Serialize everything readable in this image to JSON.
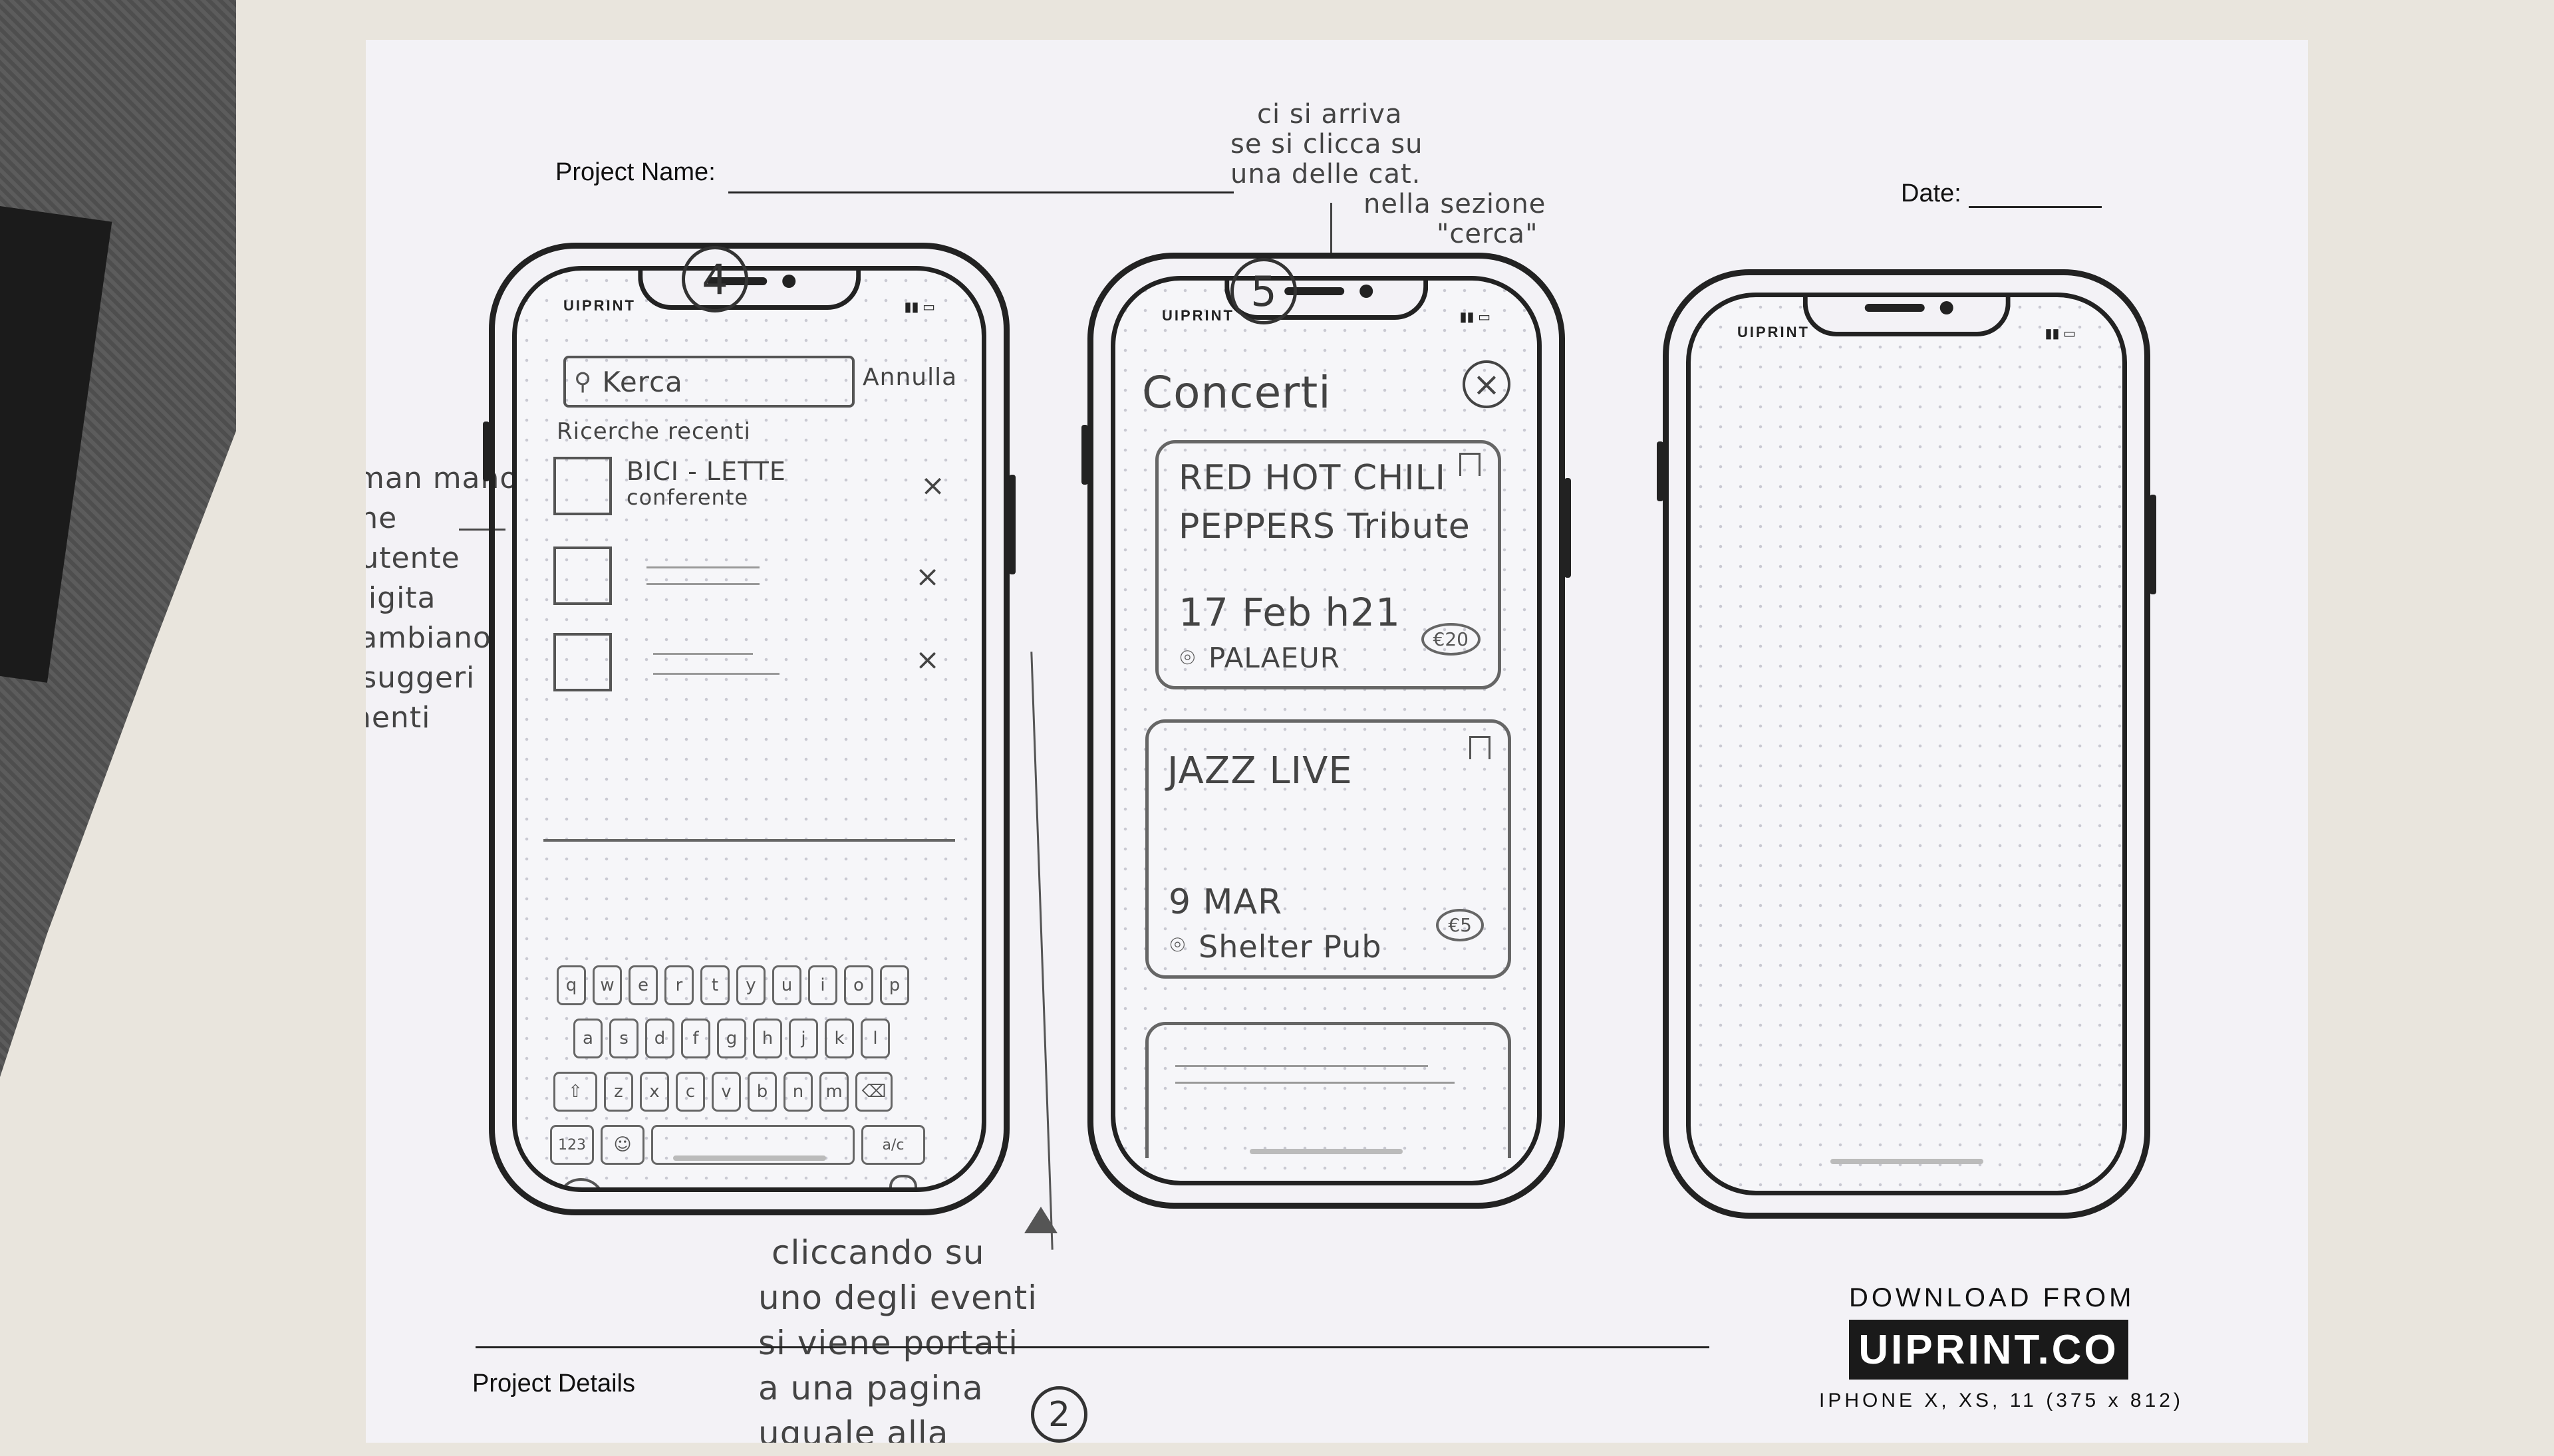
{
  "sheet": {
    "project_name_label": "Project Name:",
    "date_label": "Date:",
    "project_details_label": "Project Details",
    "download_from": "DOWNLOAD FROM",
    "uiprint_logo": "UIPRINT.CO",
    "device_spec": "IPHONE X, XS, 11 (375 x 812)"
  },
  "phone_brand": "UIPRINT",
  "annotations": {
    "top_note": [
      "ci si arriva",
      "se si clicca su",
      "una delle cat.",
      "nella sezione",
      "\"cerca\""
    ],
    "left_note": [
      "man mano",
      "che",
      "l'utente",
      "digita",
      "cambiano",
      "i suggeri",
      "menti"
    ],
    "bottom_note": [
      "cliccando su",
      "uno degli eventi",
      "si viene portati",
      "a una pagina",
      "uguale alla"
    ],
    "screen_4_number": "4",
    "screen_5_number": "5",
    "bottom_circle_number": "2"
  },
  "screen4": {
    "search_placeholder": "Kerca",
    "cancel_label": "Annulla",
    "recent_label": "Ricerche recenti",
    "recent_items": [
      {
        "line1": "BICI - LETTE",
        "line2": "conferente",
        "remove": "×"
      },
      {
        "line1": "",
        "line2": "",
        "remove": "×"
      },
      {
        "line1": "",
        "line2": "",
        "remove": "×"
      }
    ],
    "keyboard": {
      "row1": [
        "q",
        "w",
        "e",
        "r",
        "t",
        "y",
        "u",
        "i",
        "o",
        "p"
      ],
      "row2": [
        "a",
        "s",
        "d",
        "f",
        "g",
        "h",
        "j",
        "k",
        "l"
      ],
      "row3": [
        "⇧",
        "z",
        "x",
        "c",
        "v",
        "b",
        "n",
        "m",
        "⌫"
      ],
      "row4_left": "123",
      "row4_emoji": "☺",
      "row4_right": "a/c"
    }
  },
  "screen5": {
    "title": "Concerti",
    "close": "×",
    "events": [
      {
        "title_line1": "RED HOT CHILI",
        "title_line2": "PEPPERS Tribute",
        "date": "17 Feb h21",
        "place": "PALAEUR",
        "price": "€20"
      },
      {
        "title_line1": "JAZZ LIVE",
        "title_line2": "",
        "date": "9 MAR",
        "place": "Shelter Pub",
        "price": "€5"
      }
    ]
  }
}
